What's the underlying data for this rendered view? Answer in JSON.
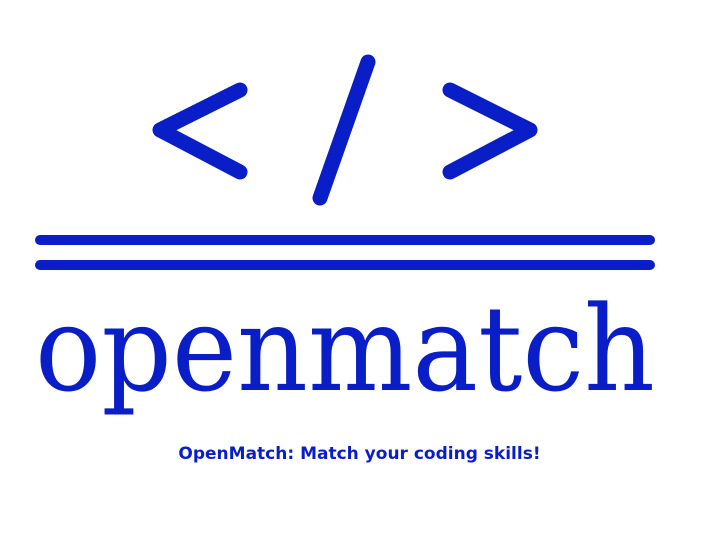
{
  "logo": {
    "symbol": "</>",
    "wordmark": "openmatch",
    "color": "#0a1ec8"
  },
  "tagline": "OpenMatch: Match your coding skills!"
}
